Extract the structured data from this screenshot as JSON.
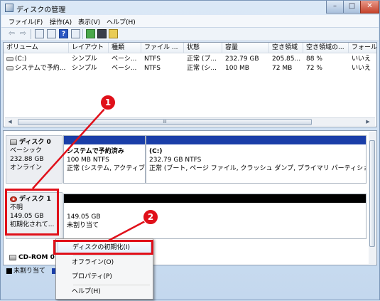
{
  "window": {
    "title": "ディスクの管理",
    "min": "–",
    "max": "□",
    "close": "✕"
  },
  "menu": [
    "ファイル(F)",
    "操作(A)",
    "表示(V)",
    "ヘルプ(H)"
  ],
  "toolbar": {
    "back": "⇦",
    "forward": "⇨",
    "help": "?"
  },
  "volume_table": {
    "columns": [
      "ボリューム",
      "レイアウト",
      "種類",
      "ファイル ...",
      "状態",
      "容量",
      "空き領域",
      "空き領域の...",
      "フォール"
    ],
    "rows": [
      [
        "(C:)",
        "シンプル",
        "ベーシ...",
        "NTFS",
        "正常 (ブ...",
        "232.79 GB",
        "205.85...",
        "88 %",
        "いいえ"
      ],
      [
        "システムで予約...",
        "シンプル",
        "ベーシ...",
        "NTFS",
        "正常 (シ...",
        "100 MB",
        "72 MB",
        "72 %",
        "いいえ"
      ]
    ],
    "scroll_grip": "III"
  },
  "disks": {
    "disk0": {
      "label": "ディスク 0",
      "type": "ベーシック",
      "size": "232.88 GB",
      "status": "オンライン",
      "partitions": [
        {
          "name": "システムで予約済み",
          "detail": "100 MB NTFS",
          "status": "正常 (システム, アクティブ"
        },
        {
          "name": "(C:)",
          "detail": "232.79 GB NTFS",
          "status": "正常 (ブート, ページ ファイル, クラッシュ ダンプ, プライマリ パーティション)"
        }
      ]
    },
    "disk1": {
      "label": "ディスク 1",
      "type": "不明",
      "size": "149.05 GB",
      "status": "初期化されて...",
      "partition": {
        "size": "149.05 GB",
        "status": "未割り当て"
      }
    },
    "cdrom": {
      "label": "CD-ROM 0"
    },
    "legend": {
      "unallocated": "未割り当て"
    }
  },
  "context_menu": [
    "ディスクの初期化(I)",
    "オフライン(O)",
    "プロパティ(P)",
    "ヘルプ(H)"
  ],
  "annotations": {
    "one": "1",
    "two": "2"
  },
  "colors": {
    "annotation": "#e0101a",
    "primary_partition": "#1a3ea8",
    "unallocated": "#000000"
  }
}
